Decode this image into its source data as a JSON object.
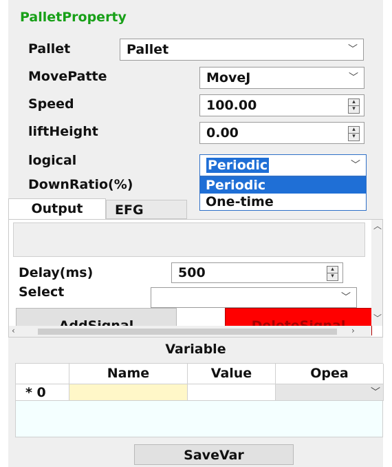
{
  "header": {
    "title": "PalletProperty"
  },
  "pallet": {
    "label": "Pallet",
    "value": "Pallet"
  },
  "move_pattern": {
    "label": "MovePatte",
    "value": "MoveJ"
  },
  "speed": {
    "label": "Speed",
    "value": "100.00"
  },
  "lift_height": {
    "label": "liftHeight",
    "value": "0.00"
  },
  "logical": {
    "label": "logical",
    "value": "Periodic",
    "options": [
      "Periodic",
      "One-time"
    ]
  },
  "down_ratio": {
    "label": "DownRatio(%)"
  },
  "tabs": [
    "Output",
    "EFG"
  ],
  "output": {
    "delay_label": "Delay(ms)",
    "delay_value": "500",
    "select_label": "Select",
    "select_value": "",
    "add_signal": "AddSignal",
    "delete_signal": "DeleteSignal"
  },
  "variable": {
    "title": "Variable",
    "columns": [
      "Name",
      "Value",
      "Opea"
    ],
    "row": {
      "marker": "* 0",
      "name": "",
      "value": ""
    },
    "save_label": "SaveVar"
  },
  "icons": {
    "dropdown": "chevron-down-icon",
    "spin": "spin-up-down-icon"
  },
  "colors": {
    "title": "#18a018",
    "selection": "#1f6fd6",
    "delete": "#ff0000",
    "name_cell": "#fff7c8",
    "grid_empty": "#f4ffff"
  }
}
